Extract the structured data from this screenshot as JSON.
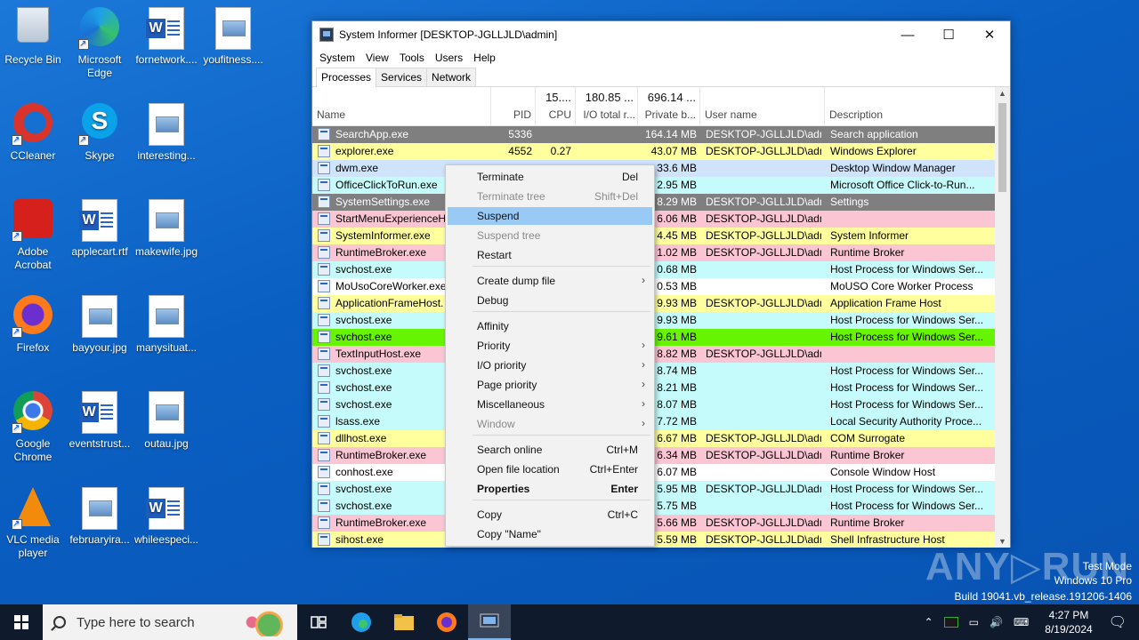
{
  "desktop": {
    "icons": [
      {
        "label": "Recycle Bin"
      },
      {
        "label": "Microsoft Edge"
      },
      {
        "label": "fornetwork...."
      },
      {
        "label": "youfitness...."
      },
      {
        "label": "CCleaner"
      },
      {
        "label": "Skype"
      },
      {
        "label": "interesting..."
      },
      {
        "label": "Adobe Acrobat"
      },
      {
        "label": "applecart.rtf"
      },
      {
        "label": "makewife.jpg"
      },
      {
        "label": "Firefox"
      },
      {
        "label": "bayyour.jpg"
      },
      {
        "label": "manysituat..."
      },
      {
        "label": "Google Chrome"
      },
      {
        "label": "eventstrust..."
      },
      {
        "label": "outau.jpg"
      },
      {
        "label": "VLC media player"
      },
      {
        "label": "februaryira..."
      },
      {
        "label": "whileespeci..."
      }
    ]
  },
  "window": {
    "title": "System Informer [DESKTOP-JGLLJLD\\admin]",
    "menu": [
      "System",
      "View",
      "Tools",
      "Users",
      "Help"
    ],
    "tabs": [
      "Processes",
      "Services",
      "Network"
    ],
    "columns": {
      "name": "Name",
      "pid": "PID",
      "cpu_total": "15....",
      "cpu": "CPU",
      "io_total": "180.85 ...",
      "io": "I/O total r...",
      "private_total": "696.14 ...",
      "private": "Private b...",
      "user": "User name",
      "desc": "Description"
    },
    "rows": [
      {
        "name": "SearchApp.exe",
        "pid": "5336",
        "cpu": "",
        "mem": "164.14 MB",
        "user": "DESKTOP-JGLLJLD\\admi",
        "desc": "Search application",
        "color": "#7f7f7f",
        "fg": "#ffffff"
      },
      {
        "name": "explorer.exe",
        "pid": "4552",
        "cpu": "0.27",
        "mem": "43.07 MB",
        "user": "DESKTOP-JGLLJLD\\admi",
        "desc": "Windows Explorer",
        "color": "#ffff9e",
        "fg": "#000000"
      },
      {
        "name": "dwm.exe",
        "pid": "",
        "cpu": "",
        "mem": "33.6 MB",
        "user": "",
        "desc": "Desktop Window Manager",
        "color": "#cfe3fb",
        "fg": "#000000"
      },
      {
        "name": "OfficeClickToRun.exe",
        "pid": "",
        "cpu": "",
        "mem": "2.95 MB",
        "user": "",
        "desc": "Microsoft Office Click-to-Run...",
        "color": "#c5fbfb",
        "fg": "#000000"
      },
      {
        "name": "SystemSettings.exe",
        "pid": "",
        "cpu": "",
        "mem": "8.29 MB",
        "user": "DESKTOP-JGLLJLD\\admi",
        "desc": "Settings",
        "color": "#7f7f7f",
        "fg": "#ffffff"
      },
      {
        "name": "StartMenuExperienceHo",
        "pid": "",
        "cpu": "",
        "mem": "6.06 MB",
        "user": "DESKTOP-JGLLJLD\\admi",
        "desc": "",
        "color": "#fbc5d4",
        "fg": "#000000"
      },
      {
        "name": "SystemInformer.exe",
        "pid": "",
        "cpu": "",
        "mem": "4.45 MB",
        "user": "DESKTOP-JGLLJLD\\admi",
        "desc": "System Informer",
        "color": "#ffff9e",
        "fg": "#000000"
      },
      {
        "name": "RuntimeBroker.exe",
        "pid": "",
        "cpu": "",
        "mem": "1.02 MB",
        "user": "DESKTOP-JGLLJLD\\admi",
        "desc": "Runtime Broker",
        "color": "#fbc5d4",
        "fg": "#000000"
      },
      {
        "name": "svchost.exe",
        "pid": "",
        "cpu": "",
        "mem": "0.68 MB",
        "user": "",
        "desc": "Host Process for Windows Ser...",
        "color": "#c5fbfb",
        "fg": "#000000"
      },
      {
        "name": "MoUsoCoreWorker.exe",
        "pid": "",
        "cpu": "",
        "mem": "0.53 MB",
        "user": "",
        "desc": "MoUSO Core Worker Process",
        "color": "#ffffff",
        "fg": "#000000"
      },
      {
        "name": "ApplicationFrameHost.",
        "pid": "",
        "cpu": "",
        "mem": "9.93 MB",
        "user": "DESKTOP-JGLLJLD\\admi",
        "desc": "Application Frame Host",
        "color": "#ffff9e",
        "fg": "#000000"
      },
      {
        "name": "svchost.exe",
        "pid": "",
        "cpu": "",
        "mem": "9.93 MB",
        "user": "",
        "desc": "Host Process for Windows Ser...",
        "color": "#c5fbfb",
        "fg": "#000000"
      },
      {
        "name": "svchost.exe",
        "pid": "",
        "cpu": "",
        "mem": "9.61 MB",
        "user": "",
        "desc": "Host Process for Windows Ser...",
        "color": "#66f400",
        "fg": "#000000"
      },
      {
        "name": "TextInputHost.exe",
        "pid": "",
        "cpu": "",
        "mem": "8.82 MB",
        "user": "DESKTOP-JGLLJLD\\admi",
        "desc": "",
        "color": "#fbc5d4",
        "fg": "#000000"
      },
      {
        "name": "svchost.exe",
        "pid": "",
        "cpu": "",
        "mem": "8.74 MB",
        "user": "",
        "desc": "Host Process for Windows Ser...",
        "color": "#c5fbfb",
        "fg": "#000000"
      },
      {
        "name": "svchost.exe",
        "pid": "",
        "cpu": "",
        "mem": "8.21 MB",
        "user": "",
        "desc": "Host Process for Windows Ser...",
        "color": "#c5fbfb",
        "fg": "#000000"
      },
      {
        "name": "svchost.exe",
        "pid": "",
        "cpu": "",
        "mem": "8.07 MB",
        "user": "",
        "desc": "Host Process for Windows Ser...",
        "color": "#c5fbfb",
        "fg": "#000000"
      },
      {
        "name": "lsass.exe",
        "pid": "",
        "cpu": "",
        "mem": "7.72 MB",
        "user": "",
        "desc": "Local Security Authority Proce...",
        "color": "#c5fbfb",
        "fg": "#000000"
      },
      {
        "name": "dllhost.exe",
        "pid": "",
        "cpu": "",
        "mem": "6.67 MB",
        "user": "DESKTOP-JGLLJLD\\admi",
        "desc": "COM Surrogate",
        "color": "#ffff9e",
        "fg": "#000000"
      },
      {
        "name": "RuntimeBroker.exe",
        "pid": "",
        "cpu": "",
        "mem": "6.34 MB",
        "user": "DESKTOP-JGLLJLD\\admi",
        "desc": "Runtime Broker",
        "color": "#fbc5d4",
        "fg": "#000000"
      },
      {
        "name": "conhost.exe",
        "pid": "",
        "cpu": "",
        "mem": "6.07 MB",
        "user": "",
        "desc": "Console Window Host",
        "color": "#ffffff",
        "fg": "#000000"
      },
      {
        "name": "svchost.exe",
        "pid": "",
        "cpu": "",
        "mem": "5.95 MB",
        "user": "DESKTOP-JGLLJLD\\admi",
        "desc": "Host Process for Windows Ser...",
        "color": "#c5fbfb",
        "fg": "#000000"
      },
      {
        "name": "svchost.exe",
        "pid": "",
        "cpu": "",
        "mem": "5.75 MB",
        "user": "",
        "desc": "Host Process for Windows Ser...",
        "color": "#c5fbfb",
        "fg": "#000000"
      },
      {
        "name": "RuntimeBroker.exe",
        "pid": "",
        "cpu": "",
        "mem": "5.66 MB",
        "user": "DESKTOP-JGLLJLD\\admi",
        "desc": "Runtime Broker",
        "color": "#fbc5d4",
        "fg": "#000000"
      },
      {
        "name": "sihost.exe",
        "pid": "",
        "cpu": "",
        "mem": "5.59 MB",
        "user": "DESKTOP-JGLLJLD\\admi",
        "desc": "Shell Infrastructure Host",
        "color": "#ffff9e",
        "fg": "#000000"
      }
    ]
  },
  "context_menu": {
    "items": [
      {
        "label": "Terminate",
        "key": "Del",
        "disabled": false
      },
      {
        "label": "Terminate tree",
        "key": "Shift+Del",
        "disabled": true
      },
      {
        "label": "Suspend",
        "key": "",
        "highlight": true
      },
      {
        "label": "Suspend tree",
        "key": "",
        "disabled": true
      },
      {
        "label": "Restart",
        "key": ""
      },
      {
        "label": "Create dump file",
        "key": "",
        "submenu": true
      },
      {
        "label": "Debug",
        "key": ""
      },
      {
        "label": "Affinity",
        "key": ""
      },
      {
        "label": "Priority",
        "key": "",
        "submenu": true
      },
      {
        "label": "I/O priority",
        "key": "",
        "submenu": true
      },
      {
        "label": "Page priority",
        "key": "",
        "submenu": true
      },
      {
        "label": "Miscellaneous",
        "key": "",
        "submenu": true
      },
      {
        "label": "Window",
        "key": "",
        "submenu": true,
        "disabled": true
      },
      {
        "label": "Search online",
        "key": "Ctrl+M"
      },
      {
        "label": "Open file location",
        "key": "Ctrl+Enter"
      },
      {
        "label": "Properties",
        "key": "Enter",
        "bold": true
      },
      {
        "label": "Copy",
        "key": "Ctrl+C"
      },
      {
        "label": "Copy \"Name\"",
        "key": ""
      }
    ]
  },
  "watermark": {
    "brand": "ANY▷RUN",
    "line1": "Test Mode",
    "line2": "Windows 10 Pro",
    "line3": "Build 19041.vb_release.191206-1406"
  },
  "taskbar": {
    "search_placeholder": "Type here to search",
    "time": "4:27 PM",
    "date": "8/19/2024"
  },
  "colors": {
    "service": "#c5fbfb",
    "own": "#ffff9e",
    "packed": "#fbc5d4",
    "suspended": "#7f7f7f",
    "new": "#66f400",
    "highlight": "#99c9f5"
  }
}
